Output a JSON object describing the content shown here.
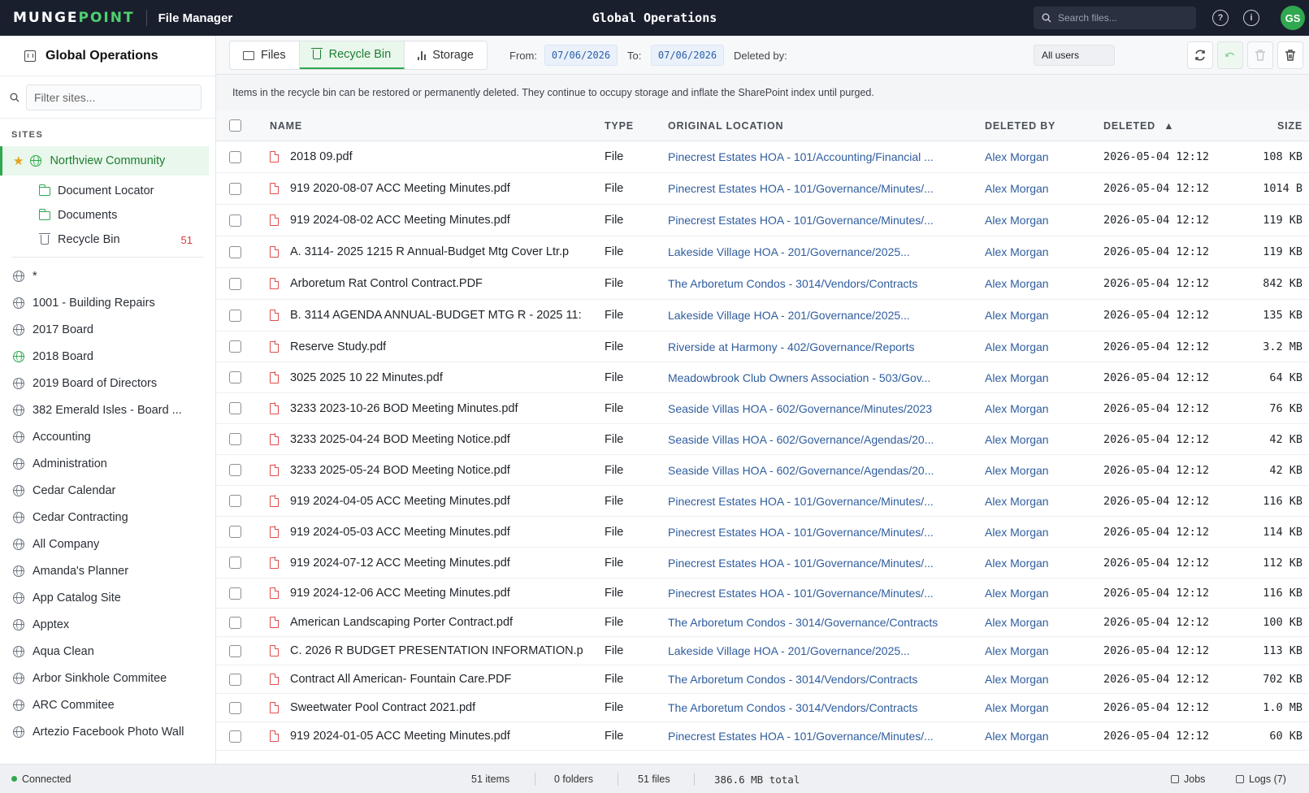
{
  "topbar": {
    "brand_a": "MUNGE",
    "brand_b": "POINT",
    "app_title": "File Manager",
    "center_title": "Global Operations",
    "search_placeholder": "Search files...",
    "avatar": "GS"
  },
  "sidebar": {
    "title": "Global Operations",
    "filter_placeholder": "Filter sites...",
    "sites_label": "SITES",
    "active_site": "Northview Community",
    "active_children": [
      {
        "label": "Document Locator",
        "icon": "folder-icon"
      },
      {
        "label": "Documents",
        "icon": "folder-icon"
      },
      {
        "label": "Recycle Bin",
        "icon": "trash-icon",
        "badge": "51"
      }
    ],
    "sites": [
      "*",
      "1001 - Building Repairs",
      "2017 Board",
      "2018 Board",
      "2019 Board of Directors",
      "382 Emerald Isles - Board ...",
      "Accounting",
      "Administration",
      "Cedar Calendar",
      "Cedar Contracting",
      "All Company",
      "Amanda's Planner",
      "App Catalog Site",
      "Apptex",
      "Aqua Clean",
      "Arbor Sinkhole Commitee",
      "ARC Commitee",
      "Artezio Facebook Photo Wall"
    ]
  },
  "toolbar": {
    "tabs": [
      "Files",
      "Recycle Bin",
      "Storage"
    ],
    "active_tab": "Recycle Bin",
    "from_label": "From:",
    "from_date": "07/06/2026",
    "to_label": "To:",
    "to_date": "07/06/2026",
    "deleted_by_label": "Deleted by:",
    "deleted_by_value": "All users"
  },
  "info_text": "Items in the recycle bin can be restored or permanently deleted. They continue to occupy storage and inflate the SharePoint index until purged.",
  "table": {
    "columns": {
      "name": "NAME",
      "type": "TYPE",
      "location": "ORIGINAL LOCATION",
      "deleted_by": "DELETED BY",
      "deleted": "DELETED",
      "size": "SIZE"
    },
    "sort_indicator": "▲",
    "rows": [
      {
        "name": "2018 09.pdf",
        "type": "File",
        "location": "Pinecrest Estates HOA - 101/Accounting/Financial ...",
        "by": "Alex Morgan",
        "deleted": "2026-05-04 12:12",
        "size": "108 KB"
      },
      {
        "name": "919 2020-08-07 ACC Meeting Minutes.pdf",
        "type": "File",
        "location": "Pinecrest Estates HOA - 101/Governance/Minutes/...",
        "by": "Alex Morgan",
        "deleted": "2026-05-04 12:12",
        "size": "1014 B"
      },
      {
        "name": "919 2024-08-02 ACC Meeting Minutes.pdf",
        "type": "File",
        "location": "Pinecrest Estates HOA - 101/Governance/Minutes/...",
        "by": "Alex Morgan",
        "deleted": "2026-05-04 12:12",
        "size": "119 KB"
      },
      {
        "name": "A. 3114- 2025 1215 R Annual-Budget Mtg Cover Ltr.p",
        "type": "File",
        "location": "Lakeside Village HOA - 201/Governance/2025...",
        "by": "Alex Morgan",
        "deleted": "2026-05-04 12:12",
        "size": "119 KB"
      },
      {
        "name": "Arboretum Rat Control Contract.PDF",
        "type": "File",
        "location": "The Arboretum Condos - 3014/Vendors/Contracts",
        "by": "Alex Morgan",
        "deleted": "2026-05-04 12:12",
        "size": "842 KB"
      },
      {
        "name": "B. 3114 AGENDA ANNUAL-BUDGET MTG R - 2025 11:",
        "type": "File",
        "location": "Lakeside Village HOA - 201/Governance/2025...",
        "by": "Alex Morgan",
        "deleted": "2026-05-04 12:12",
        "size": "135 KB"
      },
      {
        "name": "Reserve Study.pdf",
        "type": "File",
        "location": "Riverside at Harmony - 402/Governance/Reports",
        "by": "Alex Morgan",
        "deleted": "2026-05-04 12:12",
        "size": "3.2 MB"
      },
      {
        "name": "3025 2025 10 22 Minutes.pdf",
        "type": "File",
        "location": "Meadowbrook Club Owners Association - 503/Gov...",
        "by": "Alex Morgan",
        "deleted": "2026-05-04 12:12",
        "size": "64 KB"
      },
      {
        "name": "3233 2023-10-26 BOD Meeting Minutes.pdf",
        "type": "File",
        "location": "Seaside Villas HOA - 602/Governance/Minutes/2023",
        "by": "Alex Morgan",
        "deleted": "2026-05-04 12:12",
        "size": "76 KB"
      },
      {
        "name": "3233 2025-04-24 BOD Meeting Notice.pdf",
        "type": "File",
        "location": "Seaside Villas HOA - 602/Governance/Agendas/20...",
        "by": "Alex Morgan",
        "deleted": "2026-05-04 12:12",
        "size": "42 KB"
      },
      {
        "name": "3233 2025-05-24 BOD Meeting Notice.pdf",
        "type": "File",
        "location": "Seaside Villas HOA - 602/Governance/Agendas/20...",
        "by": "Alex Morgan",
        "deleted": "2026-05-04 12:12",
        "size": "42 KB"
      },
      {
        "name": "919 2024-04-05 ACC Meeting Minutes.pdf",
        "type": "File",
        "location": "Pinecrest Estates HOA - 101/Governance/Minutes/...",
        "by": "Alex Morgan",
        "deleted": "2026-05-04 12:12",
        "size": "116 KB"
      },
      {
        "name": "919 2024-05-03 ACC Meeting Minutes.pdf",
        "type": "File",
        "location": "Pinecrest Estates HOA - 101/Governance/Minutes/...",
        "by": "Alex Morgan",
        "deleted": "2026-05-04 12:12",
        "size": "114 KB"
      },
      {
        "name": "919 2024-07-12 ACC Meeting Minutes.pdf",
        "type": "File",
        "location": "Pinecrest Estates HOA - 101/Governance/Minutes/...",
        "by": "Alex Morgan",
        "deleted": "2026-05-04 12:12",
        "size": "112 KB"
      },
      {
        "name": "919 2024-12-06 ACC Meeting Minutes.pdf",
        "type": "File",
        "location": "Pinecrest Estates HOA - 101/Governance/Minutes/...",
        "by": "Alex Morgan",
        "deleted": "2026-05-04 12:12",
        "size": "116 KB"
      },
      {
        "name": "American Landscaping Porter Contract.pdf",
        "type": "File",
        "location": "The Arboretum Condos - 3014/Governance/Contracts",
        "by": "Alex Morgan",
        "deleted": "2026-05-04 12:12",
        "size": "100 KB"
      },
      {
        "name": "C. 2026 R BUDGET PRESENTATION INFORMATION.p",
        "type": "File",
        "location": "Lakeside Village HOA - 201/Governance/2025...",
        "by": "Alex Morgan",
        "deleted": "2026-05-04 12:12",
        "size": "113 KB"
      },
      {
        "name": "Contract All American- Fountain Care.PDF",
        "type": "File",
        "location": "The Arboretum Condos - 3014/Vendors/Contracts",
        "by": "Alex Morgan",
        "deleted": "2026-05-04 12:12",
        "size": "702 KB"
      },
      {
        "name": "Sweetwater Pool Contract 2021.pdf",
        "type": "File",
        "location": "The Arboretum Condos - 3014/Vendors/Contracts",
        "by": "Alex Morgan",
        "deleted": "2026-05-04 12:12",
        "size": "1.0 MB"
      },
      {
        "name": "919 2024-01-05 ACC Meeting Minutes.pdf",
        "type": "File",
        "location": "Pinecrest Estates HOA - 101/Governance/Minutes/...",
        "by": "Alex Morgan",
        "deleted": "2026-05-04 12:12",
        "size": "60 KB"
      }
    ]
  },
  "status": {
    "connection": "Connected",
    "items": "51 items",
    "folders": "0 folders",
    "files": "51 files",
    "total": "386.6 MB total",
    "jobs": "Jobs",
    "logs": "Logs (7)"
  },
  "colors": {
    "accent": "#2fa84f",
    "topbar": "#1a1f2e",
    "link": "#2f5d9e",
    "danger": "#e14b4b"
  }
}
